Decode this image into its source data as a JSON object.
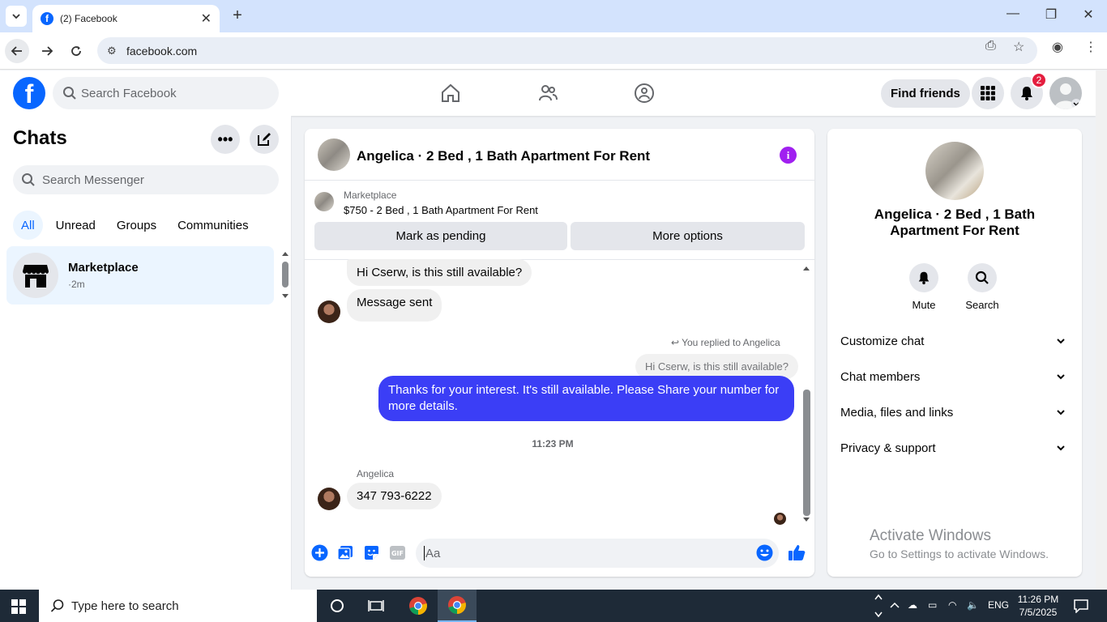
{
  "browser": {
    "tab_title": "(2) Facebook",
    "url": "facebook.com"
  },
  "fb": {
    "search_placeholder": "Search Facebook",
    "find_friends": "Find friends",
    "notification_count": "2"
  },
  "left": {
    "title": "Chats",
    "search_placeholder": "Search Messenger",
    "filters": [
      "All",
      "Unread",
      "Groups",
      "Communities"
    ],
    "chats": [
      {
        "name": "Marketplace",
        "time": "·2m"
      }
    ]
  },
  "conversation": {
    "title": "Angelica · 2 Bed , 1 Bath Apartment For Rent",
    "marketplace_label": "Marketplace",
    "listing": "$750 - 2 Bed , 1 Bath Apartment For Rent",
    "mark_pending": "Mark as pending",
    "more_options": "More options",
    "messages": {
      "m1": "Hi Cserw, is this still available?",
      "m2": "Message sent",
      "reply_note": "You replied to Angelica",
      "reply_quote": "Hi Cserw, is this still available?",
      "m3": "Thanks for your interest.  It's still available. Please Share your number for more details.",
      "timestamp": "11:23 PM",
      "sender": "Angelica",
      "m4": "347 793-6222"
    },
    "composer_placeholder": "Aa"
  },
  "right": {
    "name": "Angelica · 2 Bed , 1 Bath Apartment For Rent",
    "mute": "Mute",
    "search": "Search",
    "rows": [
      "Customize chat",
      "Chat members",
      "Media, files and links",
      "Privacy & support"
    ],
    "activate_title": "Activate Windows",
    "activate_sub": "Go to Settings to activate Windows."
  },
  "taskbar": {
    "search_placeholder": "Type here to search",
    "lang": "ENG",
    "time": "11:26 PM",
    "date": "7/5/2025"
  },
  "colors": {
    "fb_blue": "#0866ff",
    "outgoing_bubble": "#3b3ef6",
    "info_purple": "#a020f0",
    "badge_red": "#e41e3f"
  }
}
